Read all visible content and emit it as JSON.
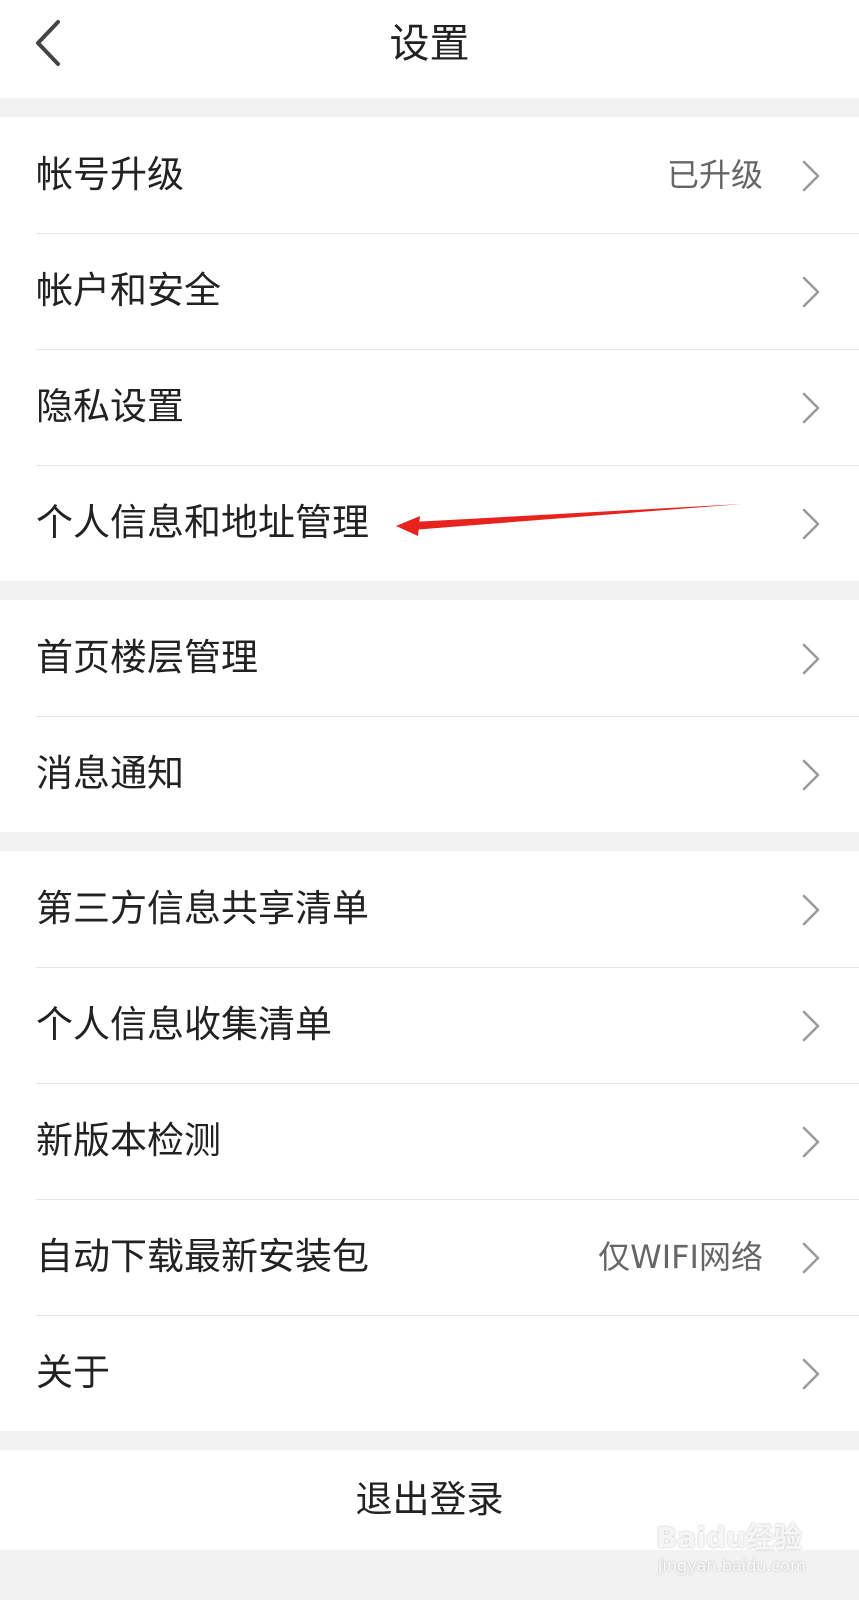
{
  "header": {
    "title": "设置",
    "back_icon": "chevron-left-icon"
  },
  "groups": [
    {
      "items": [
        {
          "label": "帐号升级",
          "value": "已升级"
        },
        {
          "label": "帐户和安全",
          "value": ""
        },
        {
          "label": "隐私设置",
          "value": ""
        },
        {
          "label": "个人信息和地址管理",
          "value": ""
        }
      ]
    },
    {
      "items": [
        {
          "label": "首页楼层管理",
          "value": ""
        },
        {
          "label": "消息通知",
          "value": ""
        }
      ]
    },
    {
      "items": [
        {
          "label": "第三方信息共享清单",
          "value": ""
        },
        {
          "label": "个人信息收集清单",
          "value": ""
        },
        {
          "label": "新版本检测",
          "value": ""
        },
        {
          "label": "自动下载最新安装包",
          "value": "仅WIFI网络"
        },
        {
          "label": "关于",
          "value": ""
        }
      ]
    }
  ],
  "logout": {
    "label": "退出登录"
  },
  "annotation": {
    "color": "#e8221c",
    "target": "个人信息和地址管理"
  },
  "watermark": {
    "brand": "Baidu经验",
    "url": "jingyan.baidu.com"
  },
  "colors": {
    "background": "#f2f2f2",
    "surface": "#ffffff",
    "text": "#222222",
    "secondary_text": "#666666",
    "divider": "#e5e5e5",
    "chevron": "#9a9a9a"
  }
}
